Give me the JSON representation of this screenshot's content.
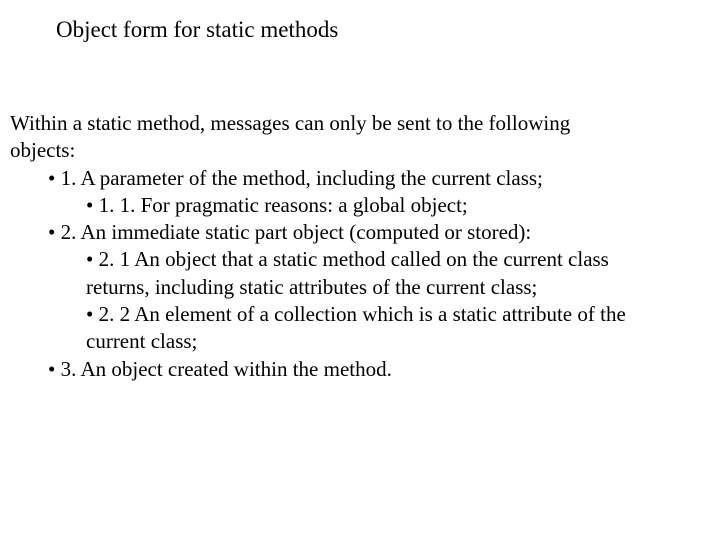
{
  "title": "Object form for static methods",
  "intro_line1": "Within a static method, messages can only be sent to the following",
  "intro_line2": "objects:",
  "item1": "• 1. A parameter of the method, including the current class;",
  "item1_1": "• 1. 1. For pragmatic reasons: a global object;",
  "item2": "• 2. An immediate static part object (computed or stored):",
  "item2_1_line1": "• 2. 1 An object that a static method called on the current class",
  "item2_1_line2": "returns, including static attributes of the current class;",
  "item2_2_line1": "• 2. 2 An element of a collection which is a static attribute of the",
  "item2_2_line2": "current class;",
  "item3": "• 3. An object created within the method."
}
